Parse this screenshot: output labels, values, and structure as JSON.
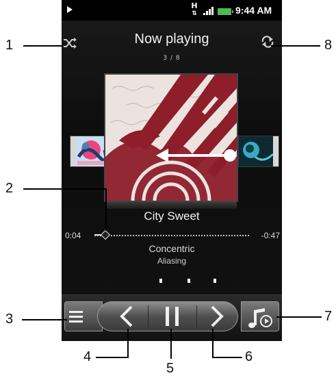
{
  "status_bar": {
    "time": "9:44 AM",
    "data_indicator": "H",
    "icons": [
      "play-icon",
      "data-transfer-icon",
      "signal-icon",
      "battery-icon"
    ]
  },
  "header": {
    "title": "Now playing",
    "track_position": "3 / 8",
    "shuffle_icon": "shuffle-icon",
    "repeat_icon": "repeat-icon"
  },
  "track": {
    "title": "City Sweet",
    "artist": "Concentric",
    "album": "Aliasing",
    "elapsed": "0:04",
    "remaining": "-0:47",
    "progress_fraction": 0.08
  },
  "controls": {
    "menu_icon": "menu-icon",
    "previous_icon": "previous-icon",
    "pause_icon": "pause-icon",
    "next_icon": "next-icon",
    "library_icon": "music-library-icon"
  },
  "callouts": [
    "1",
    "2",
    "3",
    "4",
    "5",
    "6",
    "7",
    "8"
  ],
  "colors": {
    "screen_background": "#111111",
    "battery": "#41c441",
    "art_primary": "#8d1e2a",
    "callout": "#000000"
  }
}
